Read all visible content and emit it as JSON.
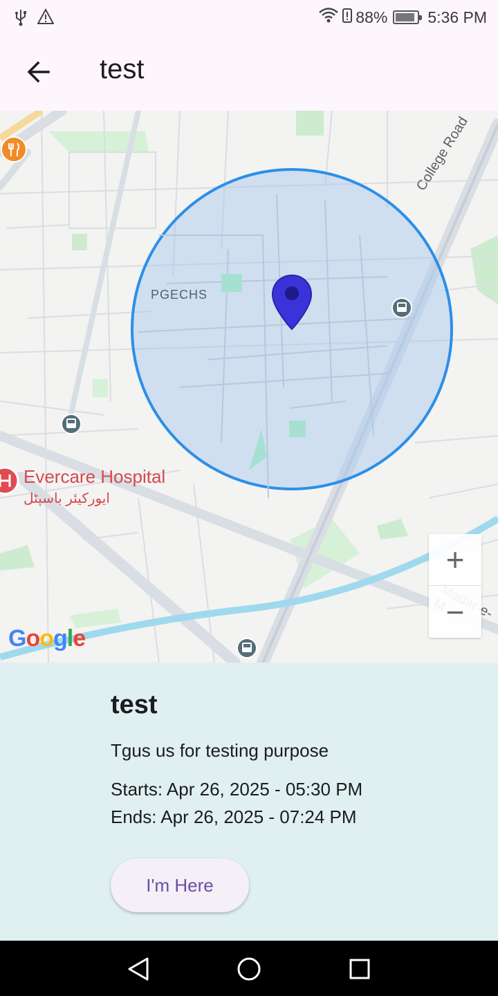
{
  "status_bar": {
    "battery_percent": "88%",
    "time": "5:36 PM",
    "icons": [
      "usb-icon",
      "warning-icon",
      "wifi-icon",
      "battery-alert-icon",
      "battery-icon"
    ]
  },
  "app_bar": {
    "title": "test",
    "back_icon": "arrow-left-icon"
  },
  "map": {
    "labels": {
      "area": "PGECHS",
      "hospital": "Evercare Hospital",
      "hospital_urdu": "ایورکیئر باسپٹل",
      "road_college": "College Road",
      "road_madar": "Madar-e-M",
      "attribution": "Google"
    },
    "zoom_in": "+",
    "zoom_out": "−",
    "geofence_color": "#2b8fe8",
    "marker_color": "#3a33d9"
  },
  "event": {
    "title": "test",
    "description": "Tgus us for testing purpose",
    "starts": "Starts: Apr 26, 2025 - 05:30 PM",
    "ends": "Ends: Apr 26, 2025 - 07:24 PM",
    "button_label": "I'm Here"
  },
  "nav_bar": {
    "buttons": [
      "back-triangle-icon",
      "home-circle-icon",
      "recents-square-icon"
    ]
  }
}
